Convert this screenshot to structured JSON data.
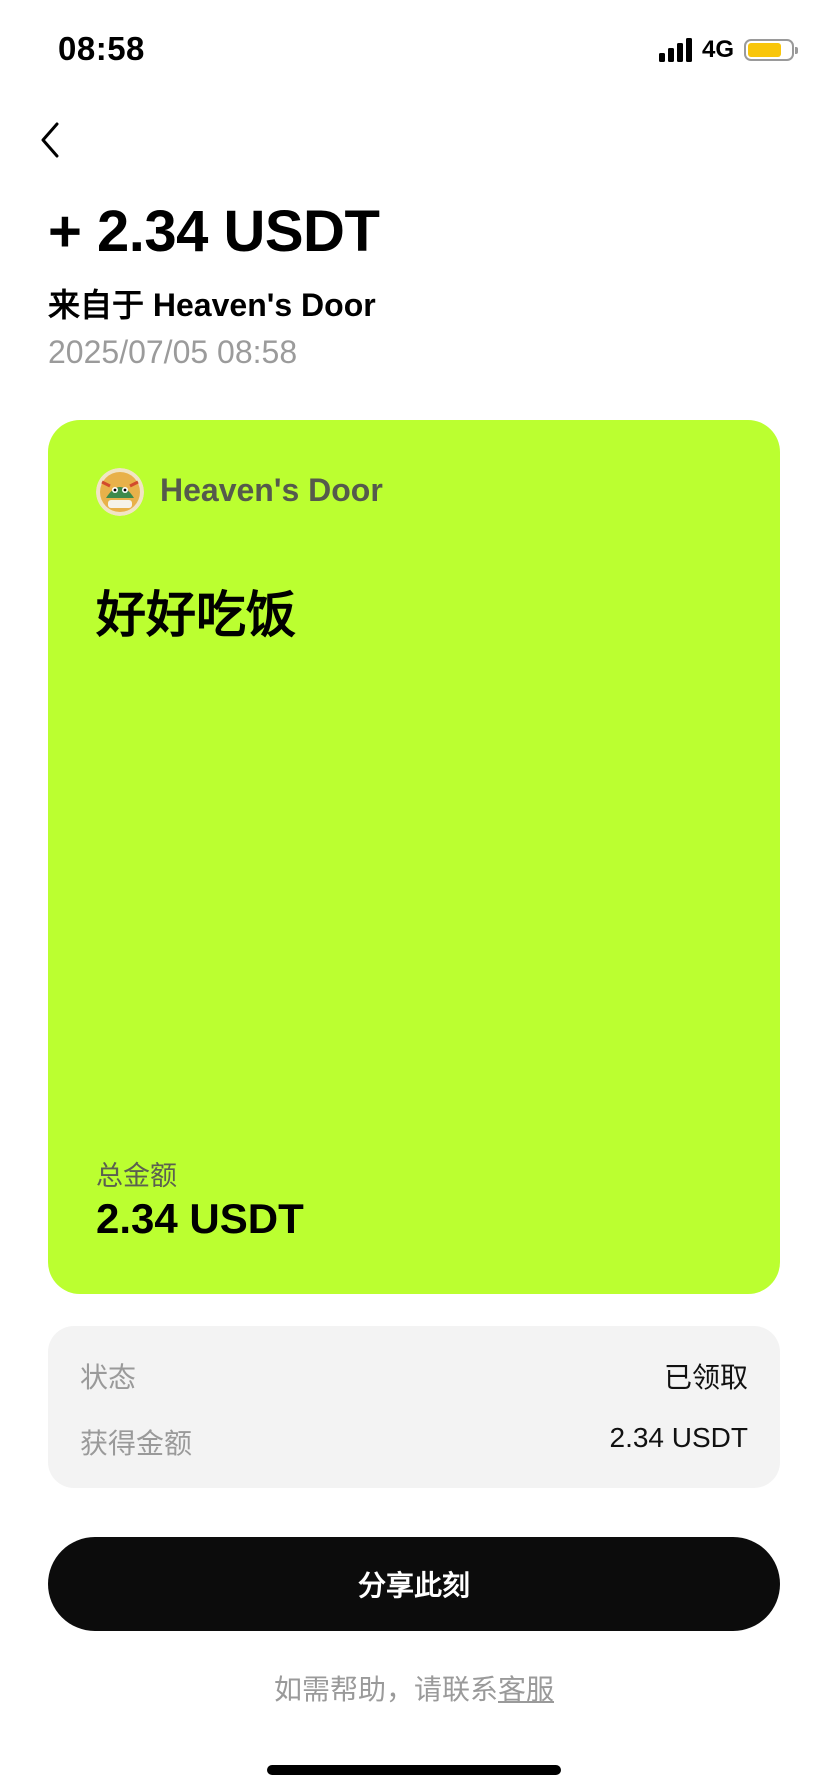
{
  "status_bar": {
    "time": "08:58",
    "network": "4G",
    "battery_color": "#f9c60a"
  },
  "header": {
    "back_icon": "chevron-left-icon",
    "amount": "+ 2.34 USDT",
    "sender_line": "来自于 Heaven's Door",
    "datetime": "2025/07/05 08:58"
  },
  "card": {
    "background": "#bbff30",
    "sender_name": "Heaven's Door",
    "message": "好好吃饭",
    "total_label": "总金额",
    "total_value": "2.34 USDT"
  },
  "details": {
    "rows": [
      {
        "label": "状态",
        "value": "已领取"
      },
      {
        "label": "获得金额",
        "value": "2.34 USDT"
      }
    ]
  },
  "actions": {
    "share_label": "分享此刻"
  },
  "help": {
    "prefix": "如需帮助，请联系",
    "link_label": "客服"
  }
}
